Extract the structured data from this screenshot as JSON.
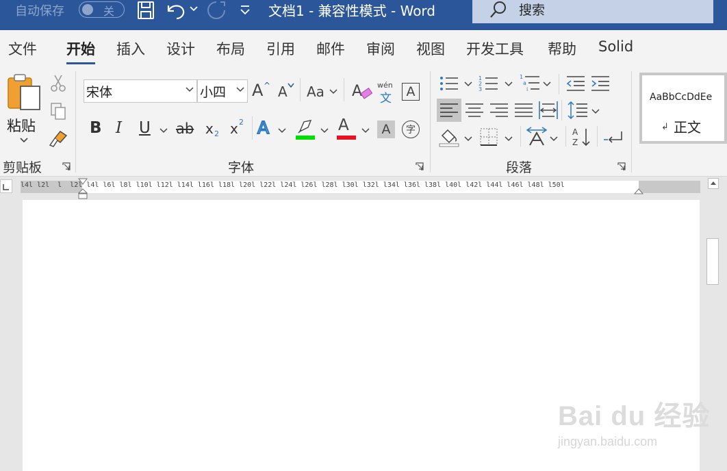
{
  "quick_access": {
    "autosave_label": "自动保存",
    "autosave_state": "关",
    "icons": [
      "save-icon",
      "undo-icon",
      "redo-icon",
      "customize-icon"
    ]
  },
  "window": {
    "title": "文档1  -  兼容性模式  -  Word",
    "search_label": "搜索"
  },
  "tabs": [
    "文件",
    "开始",
    "插入",
    "设计",
    "布局",
    "引用",
    "邮件",
    "审阅",
    "视图",
    "开发工具",
    "帮助",
    "Solid"
  ],
  "active_tab": "开始",
  "ribbon": {
    "clipboard": {
      "group_label": "剪贴板",
      "paste_label": "粘贴"
    },
    "font": {
      "group_label": "字体",
      "font_name": "宋体",
      "font_size": "小四",
      "grow_font": "A",
      "shrink_font": "A",
      "change_case": "Aa",
      "bold": "B",
      "italic": "I",
      "underline": "U",
      "strikethrough": "ab",
      "subscript": "x",
      "subscript_mark": "2",
      "superscript": "x",
      "superscript_mark": "2",
      "text_effects": "A",
      "font_color": "A",
      "char_shading": "A",
      "enclose_char": "字",
      "phonetic_top": "wén",
      "phonetic_bottom": "文",
      "char_border": "A",
      "highlight_color": "#00e000",
      "font_color_value": "#e81123"
    },
    "paragraph": {
      "group_label": "段落"
    },
    "styles": {
      "sample_text": "AaBbCcDdEe",
      "style_name": "正文"
    }
  },
  "ruler": {
    "labels": "l4l l2l  l  l2l l4l l6l l8l l10l l12l l14l l16l l18l l20l l22l l24l l26l l28l l30l l32l l34l l36l l38l l40l l42l l44l l46l l48l l50l"
  },
  "watermark": {
    "brand": "Bai du 经验",
    "url": "jingyan.baidu.com"
  }
}
